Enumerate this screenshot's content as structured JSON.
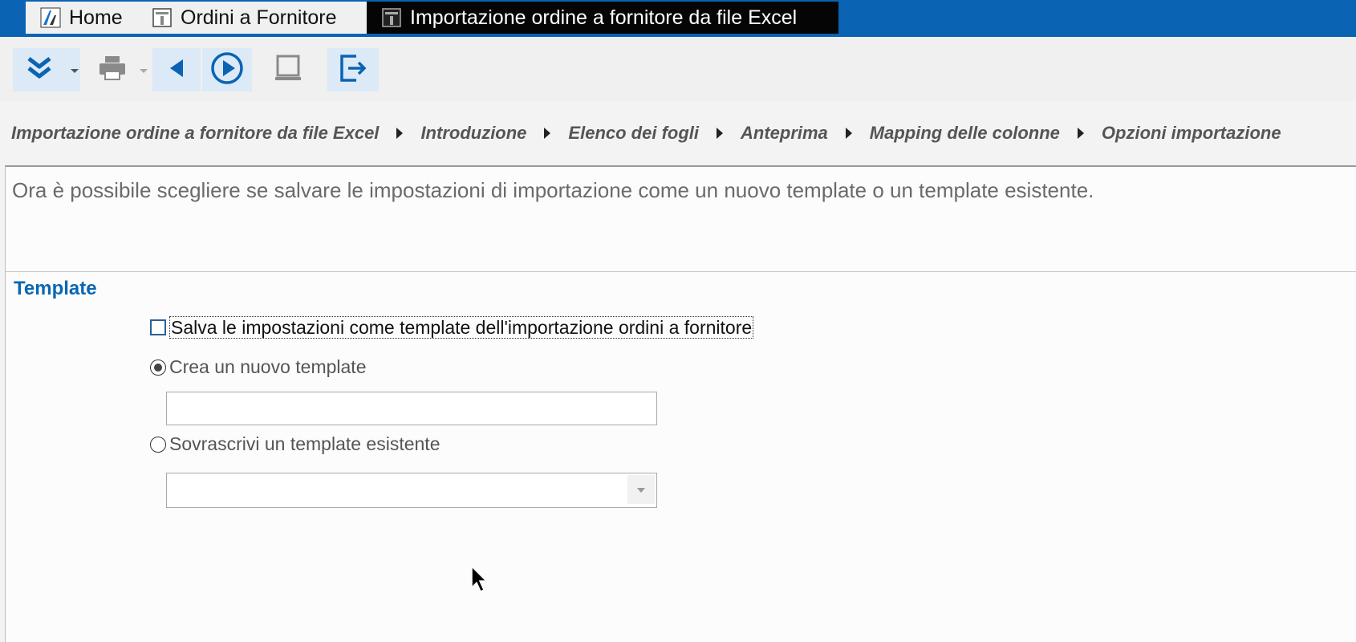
{
  "tabs": [
    {
      "label": "Home",
      "icon": "app-logo-icon"
    },
    {
      "label": "Ordini a Fornitore",
      "icon": "form-icon"
    },
    {
      "label": "Importazione ordine a fornitore da file Excel",
      "icon": "form-icon",
      "active": true
    }
  ],
  "toolbar": {
    "buttons": [
      "expand-menu",
      "print",
      "back",
      "next",
      "screen",
      "exit"
    ]
  },
  "breadcrumb": [
    "Importazione ordine a fornitore da file Excel",
    "Introduzione",
    "Elenco dei fogli",
    "Anteprima",
    "Mapping delle colonne",
    "Opzioni importazione"
  ],
  "content": {
    "intro": "Ora è possibile scegliere se salvare le impostazioni di importazione come un nuovo template o un template esistente.",
    "section_title": "Template",
    "save_checkbox_label": "Salva le impostazioni come template dell'importazione ordini a fornitore",
    "save_checked": false,
    "radio_new_label": "Crea un nuovo template",
    "radio_overwrite_label": "Sovrascrivi un template esistente",
    "selected_option": "new",
    "new_template_value": "",
    "existing_template_value": ""
  },
  "colors": {
    "accent": "#0a63b3",
    "section_title": "#0a67b4",
    "active_tab": "#050505"
  }
}
